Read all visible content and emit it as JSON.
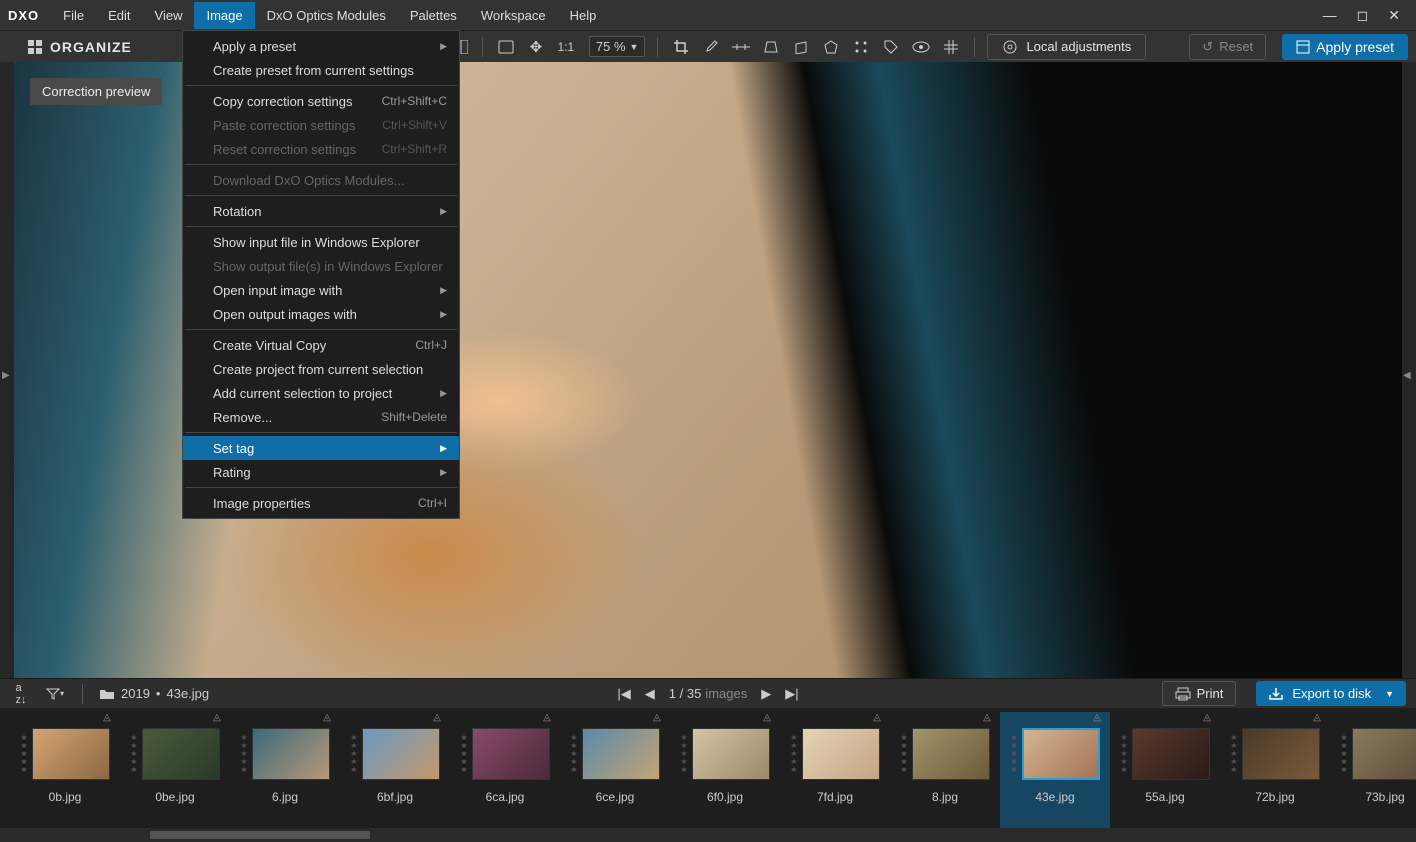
{
  "app": {
    "logo": "DXO"
  },
  "menubar": {
    "items": [
      "File",
      "Edit",
      "View",
      "Image",
      "DxO Optics Modules",
      "Palettes",
      "Workspace",
      "Help"
    ],
    "active_index": 3
  },
  "toolbar": {
    "organize": "ORGANIZE",
    "ratio_label": "1:1",
    "zoom_value": "75 %",
    "local_adjustments": "Local adjustments",
    "reset": "Reset",
    "apply_preset": "Apply preset"
  },
  "correction_preview": "Correction preview",
  "dropdown": {
    "items": [
      {
        "label": "Apply a preset",
        "shortcut": "",
        "arrow": true,
        "disabled": false
      },
      {
        "label": "Create preset from current settings",
        "shortcut": "",
        "disabled": false
      },
      {
        "sep": true
      },
      {
        "label": "Copy correction settings",
        "shortcut": "Ctrl+Shift+C",
        "disabled": false
      },
      {
        "label": "Paste correction settings",
        "shortcut": "Ctrl+Shift+V",
        "disabled": true
      },
      {
        "label": "Reset correction settings",
        "shortcut": "Ctrl+Shift+R",
        "disabled": true
      },
      {
        "sep": true
      },
      {
        "label": "Download DxO Optics Modules...",
        "shortcut": "",
        "disabled": true
      },
      {
        "sep": true
      },
      {
        "label": "Rotation",
        "shortcut": "",
        "arrow": true,
        "disabled": false
      },
      {
        "sep": true
      },
      {
        "label": "Show input file in Windows Explorer",
        "shortcut": "",
        "disabled": false
      },
      {
        "label": "Show output file(s) in Windows Explorer",
        "shortcut": "",
        "disabled": true
      },
      {
        "label": "Open input image with",
        "shortcut": "",
        "arrow": true,
        "disabled": false
      },
      {
        "label": "Open output images with",
        "shortcut": "",
        "arrow": true,
        "disabled": false
      },
      {
        "sep": true
      },
      {
        "label": "Create Virtual Copy",
        "shortcut": "Ctrl+J",
        "disabled": false
      },
      {
        "label": "Create project from current selection",
        "shortcut": "",
        "disabled": false
      },
      {
        "label": "Add current selection to project",
        "shortcut": "",
        "arrow": true,
        "disabled": false
      },
      {
        "label": "Remove...",
        "shortcut": "Shift+Delete",
        "disabled": false
      },
      {
        "sep": true
      },
      {
        "label": "Set tag",
        "shortcut": "",
        "arrow": true,
        "disabled": false,
        "highlight": true
      },
      {
        "label": "Rating",
        "shortcut": "",
        "arrow": true,
        "disabled": false
      },
      {
        "sep": true
      },
      {
        "label": "Image properties",
        "shortcut": "Ctrl+I",
        "disabled": false
      }
    ]
  },
  "infobar": {
    "folder": "2019",
    "filename": "43e.jpg",
    "counter": "1 / 35",
    "counter_label": "images",
    "print": "Print",
    "export": "Export to disk"
  },
  "filmstrip": {
    "items": [
      {
        "name": "0b.jpg",
        "cls": "tg1"
      },
      {
        "name": "0be.jpg",
        "cls": "tg2"
      },
      {
        "name": "6.jpg",
        "cls": "tg3"
      },
      {
        "name": "6bf.jpg",
        "cls": "tg4"
      },
      {
        "name": "6ca.jpg",
        "cls": "tg5"
      },
      {
        "name": "6ce.jpg",
        "cls": "tg6"
      },
      {
        "name": "6f0.jpg",
        "cls": "tg7"
      },
      {
        "name": "7fd.jpg",
        "cls": "tg8"
      },
      {
        "name": "8.jpg",
        "cls": "tg9"
      },
      {
        "name": "43e.jpg",
        "cls": "tg10",
        "selected": true
      },
      {
        "name": "55a.jpg",
        "cls": "tg11"
      },
      {
        "name": "72b.jpg",
        "cls": "tg12"
      },
      {
        "name": "73b.jpg",
        "cls": "tg13"
      }
    ]
  }
}
